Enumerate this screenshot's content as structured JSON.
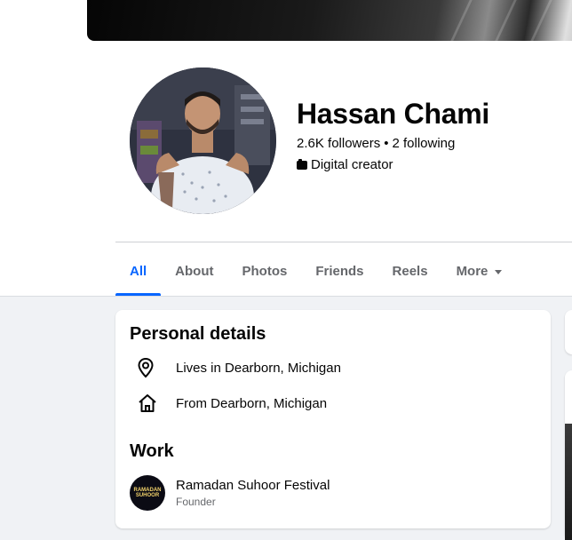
{
  "profile": {
    "name": "Hassan Chami",
    "followers": "2.6K followers",
    "following": "2 following",
    "separator": "•",
    "category": "Digital creator"
  },
  "tabs": [
    {
      "label": "All",
      "active": true
    },
    {
      "label": "About",
      "active": false
    },
    {
      "label": "Photos",
      "active": false
    },
    {
      "label": "Friends",
      "active": false
    },
    {
      "label": "Reels",
      "active": false
    },
    {
      "label": "More",
      "active": false
    }
  ],
  "personal_details": {
    "heading": "Personal details",
    "lives_in": "Lives in Dearborn, Michigan",
    "from": "From Dearborn, Michigan"
  },
  "work": {
    "heading": "Work",
    "title": "Ramadan Suhoor Festival",
    "role": "Founder",
    "logo_text": "RAMADAN SUHOOR"
  },
  "colors": {
    "accent": "#0866ff",
    "secondary_text": "#65676b",
    "feed_background": "#f0f2f5"
  }
}
